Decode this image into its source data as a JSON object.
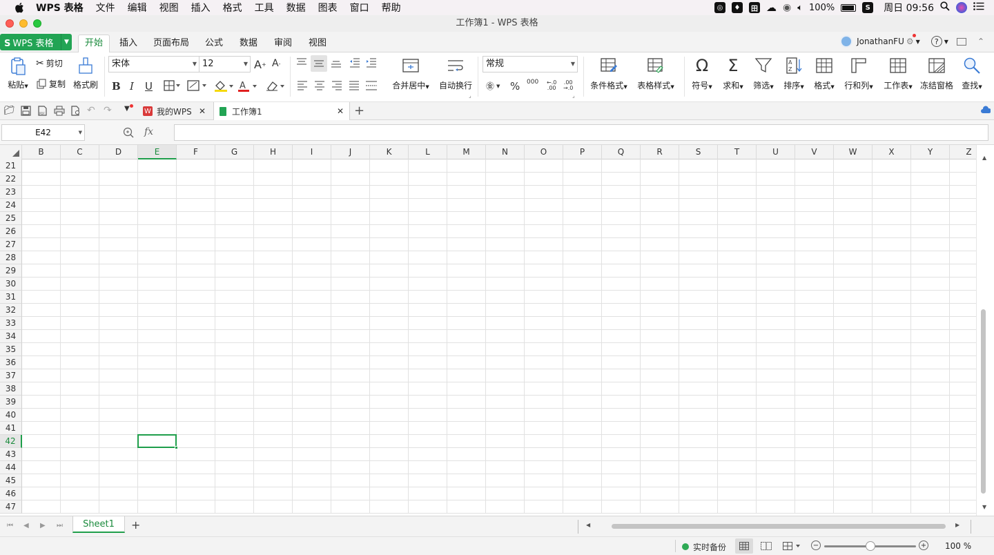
{
  "menubar": {
    "app": "WPS 表格",
    "items": [
      "文件",
      "编辑",
      "视图",
      "插入",
      "格式",
      "工具",
      "数据",
      "图表",
      "窗口",
      "帮助"
    ],
    "battery": "100%",
    "clock": "周日 09:56"
  },
  "window": {
    "title": "工作簿1 - WPS 表格"
  },
  "ribbon": {
    "app_button": "WPS 表格",
    "tabs": [
      "开始",
      "插入",
      "页面布局",
      "公式",
      "数据",
      "审阅",
      "视图"
    ],
    "active_tab": "开始",
    "user": "JonathanFU",
    "paste": "粘贴",
    "cut": "剪切",
    "copy": "复制",
    "format_painter": "格式刷",
    "font_name": "宋体",
    "font_size": "12",
    "merge_center": "合并居中",
    "wrap_text": "自动换行",
    "number_format": "常规",
    "conditional_format": "条件格式",
    "table_style": "表格样式",
    "symbol": "符号",
    "sum": "求和",
    "filter": "筛选",
    "sort": "排序",
    "format": "格式",
    "row_col": "行和列",
    "worksheet": "工作表",
    "freeze": "冻结窗格",
    "find": "查找",
    "percent_symbol": "%",
    "thousands_symbol": "000"
  },
  "doc_tabs": [
    {
      "label": "我的WPS"
    },
    {
      "label": "工作簿1"
    }
  ],
  "formula_bar": {
    "name_box": "E42",
    "fx": "fx",
    "value": ""
  },
  "sheet": {
    "columns": [
      "B",
      "C",
      "D",
      "E",
      "F",
      "G",
      "H",
      "I",
      "J",
      "K",
      "L",
      "M",
      "N",
      "O",
      "P",
      "Q",
      "R",
      "S",
      "T",
      "U",
      "V",
      "W",
      "X",
      "Y",
      "Z"
    ],
    "rows": [
      "21",
      "22",
      "23",
      "24",
      "25",
      "26",
      "27",
      "28",
      "29",
      "30",
      "31",
      "32",
      "33",
      "34",
      "35",
      "36",
      "37",
      "38",
      "39",
      "40",
      "41",
      "42",
      "43",
      "44",
      "45",
      "46",
      "47"
    ],
    "selected_column": "E",
    "selected_row": "42"
  },
  "sheet_tabs": {
    "tabs": [
      "Sheet1"
    ],
    "add": "+"
  },
  "status": {
    "backup": "实时备份",
    "zoom": "100 %"
  },
  "colors": {
    "accent": "#22a454",
    "selection": "#1e9e4a"
  }
}
